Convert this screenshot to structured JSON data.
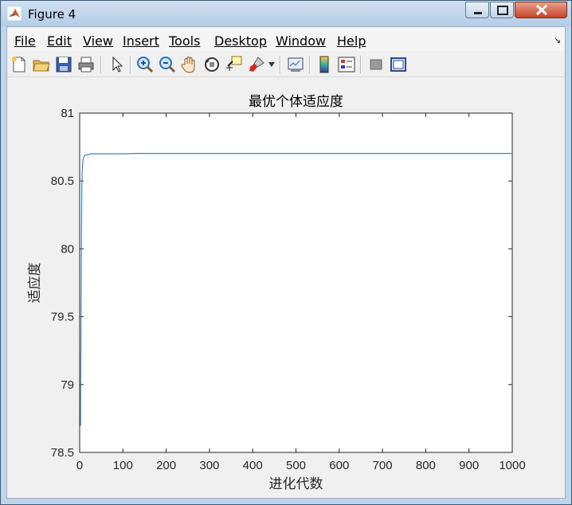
{
  "window": {
    "title": "Figure 4"
  },
  "menu": {
    "items": [
      {
        "label": "File",
        "mnemonic_index": 0
      },
      {
        "label": "Edit",
        "mnemonic_index": 0
      },
      {
        "label": "View",
        "mnemonic_index": 0
      },
      {
        "label": "Insert",
        "mnemonic_index": 0
      },
      {
        "label": "Tools",
        "mnemonic_index": 0
      },
      {
        "label": "Desktop",
        "mnemonic_index": 0
      },
      {
        "label": "Window",
        "mnemonic_index": 0
      },
      {
        "label": "Help",
        "mnemonic_index": 0
      }
    ]
  },
  "toolbar": {
    "icons": [
      "new-figure-icon",
      "open-file-icon",
      "save-icon",
      "print-icon",
      "edit-plot-arrow-icon",
      "zoom-in-icon",
      "zoom-out-icon",
      "pan-hand-icon",
      "rotate-3d-icon",
      "data-cursor-icon",
      "brush-icon",
      "link-plot-icon",
      "insert-colorbar-icon",
      "insert-legend-icon",
      "hide-plot-tools-icon",
      "show-plot-tools-icon"
    ]
  },
  "chart_data": {
    "type": "line",
    "title": "最优个体适应度",
    "xlabel": "进化代数",
    "ylabel": "适应度",
    "xlim": [
      0,
      1000
    ],
    "ylim": [
      78.5,
      81
    ],
    "xticks": [
      0,
      100,
      200,
      300,
      400,
      500,
      600,
      700,
      800,
      900,
      1000
    ],
    "xtick_labels": [
      "0",
      "100",
      "200",
      "300",
      "400",
      "500",
      "600",
      "700",
      "800",
      "900",
      "1000"
    ],
    "yticks": [
      78.5,
      79,
      79.5,
      80,
      80.5,
      81
    ],
    "ytick_labels": [
      "78.5",
      "79",
      "79.5",
      "80",
      "80.5",
      "81"
    ],
    "grid": false,
    "series": [
      {
        "color": "#3a86b4",
        "x": [
          1,
          2,
          3,
          4,
          5,
          6,
          7,
          8,
          10,
          12,
          15,
          20,
          25,
          30,
          40,
          60,
          100,
          130,
          200,
          400,
          600,
          800,
          1000
        ],
        "y": [
          78.7,
          78.7,
          79.4,
          80.0,
          80.45,
          80.58,
          80.63,
          80.66,
          80.68,
          80.69,
          80.69,
          80.695,
          80.7,
          80.7,
          80.7,
          80.7,
          80.7,
          80.703,
          80.703,
          80.703,
          80.703,
          80.703,
          80.703
        ]
      }
    ]
  }
}
